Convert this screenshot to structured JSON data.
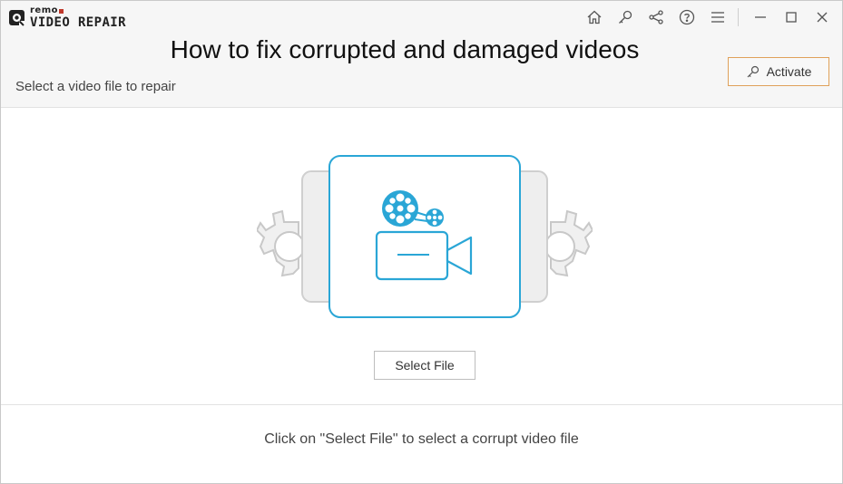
{
  "app": {
    "brand": "remo",
    "product": "VIDEO REPAIR"
  },
  "titlebar": {
    "icons": [
      "home-icon",
      "key-icon",
      "share-icon",
      "help-icon",
      "menu-icon",
      "minimize-icon",
      "maximize-icon",
      "close-icon"
    ]
  },
  "header": {
    "overlay_title": "How to fix corrupted and damaged videos",
    "subtitle": "Select a video file to repair",
    "activate_label": "Activate"
  },
  "main": {
    "select_file_label": "Select File",
    "hint": "Click on \"Select File\" to select a corrupt video file"
  },
  "colors": {
    "accent_blue": "#2aa6d6",
    "activate_border": "#e0a15a",
    "gear_gray": "#d6d6d6",
    "brand_red": "#c0392b"
  }
}
